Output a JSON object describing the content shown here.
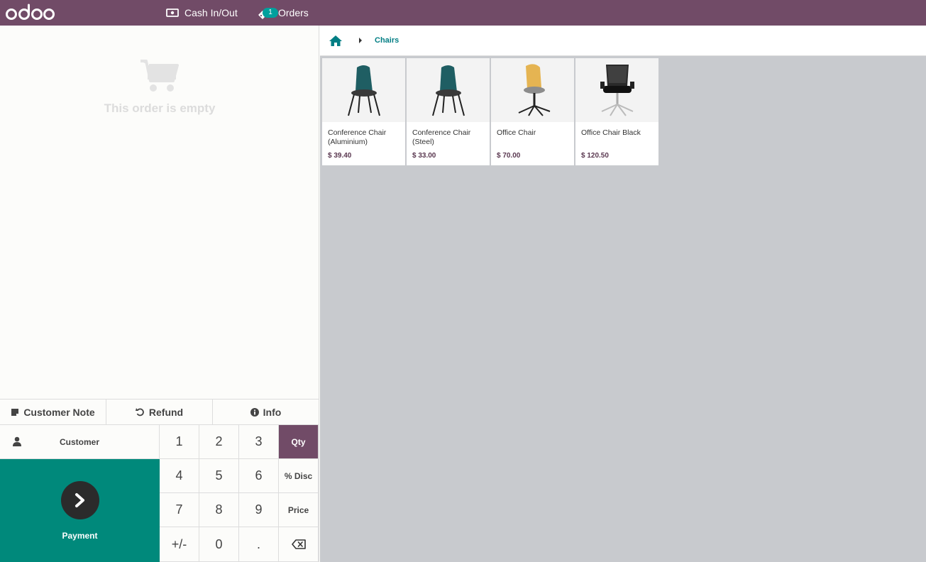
{
  "header": {
    "logo_text": "odoo",
    "cash_label": "Cash In/Out",
    "orders_label": "Orders",
    "orders_badge": "1"
  },
  "order": {
    "empty_text": "This order is empty"
  },
  "controls": {
    "customer_note": "Customer Note",
    "refund": "Refund",
    "info": "Info",
    "customer": "Customer",
    "payment": "Payment"
  },
  "numpad": {
    "keys": [
      "1",
      "2",
      "3",
      "Qty",
      "4",
      "5",
      "6",
      "% Disc",
      "7",
      "8",
      "9",
      "Price",
      "+/-",
      "0",
      ".",
      "backspace"
    ],
    "active_mode": "Qty"
  },
  "breadcrumb": {
    "category": "Chairs"
  },
  "products": [
    {
      "name": "Conference Chair (Aluminium)",
      "price": "$ 39.40",
      "image": "teal-chair"
    },
    {
      "name": "Conference Chair (Steel)",
      "price": "$ 33.00",
      "image": "teal-chair"
    },
    {
      "name": "Office Chair",
      "price": "$ 70.00",
      "image": "yellow-swivel-chair"
    },
    {
      "name": "Office Chair Black",
      "price": "$ 120.50",
      "image": "black-office-chair"
    }
  ],
  "colors": {
    "brand": "#714b67",
    "accent": "#00897b",
    "link": "#017e84",
    "products_bg": "#c8cace"
  }
}
